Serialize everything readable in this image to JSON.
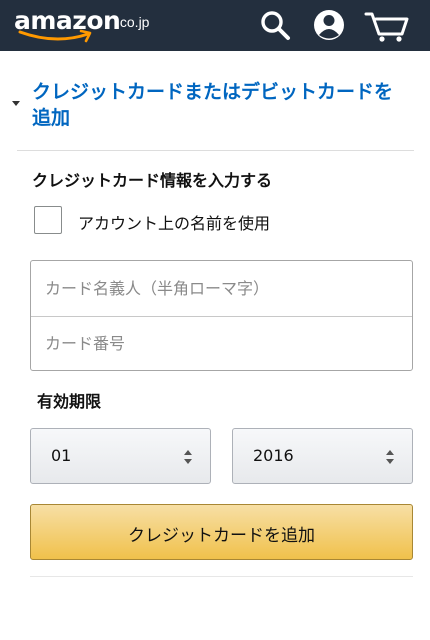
{
  "header": {
    "logo_text": "amazon",
    "logo_tld": ".co.jp",
    "icons": [
      "search-icon",
      "account-icon",
      "cart-icon"
    ],
    "background_color": "#232f3e",
    "accent_color": "#ff9900"
  },
  "section": {
    "title": "クレジットカードまたはデビットカードを追加",
    "title_color": "#0066c0"
  },
  "form": {
    "heading": "クレジットカード情報を入力する",
    "use_account_name_label": "アカウント上の名前を使用",
    "use_account_name_checked": false,
    "cardholder_placeholder": "カード名義人（半角ローマ字）",
    "cardholder_value": "",
    "card_number_placeholder": "カード番号",
    "card_number_value": "",
    "expiry_label": "有効期限",
    "expiry_month": "01",
    "expiry_year": "2016",
    "submit_label": "クレジットカードを追加",
    "submit_color": "#f0c14b"
  }
}
